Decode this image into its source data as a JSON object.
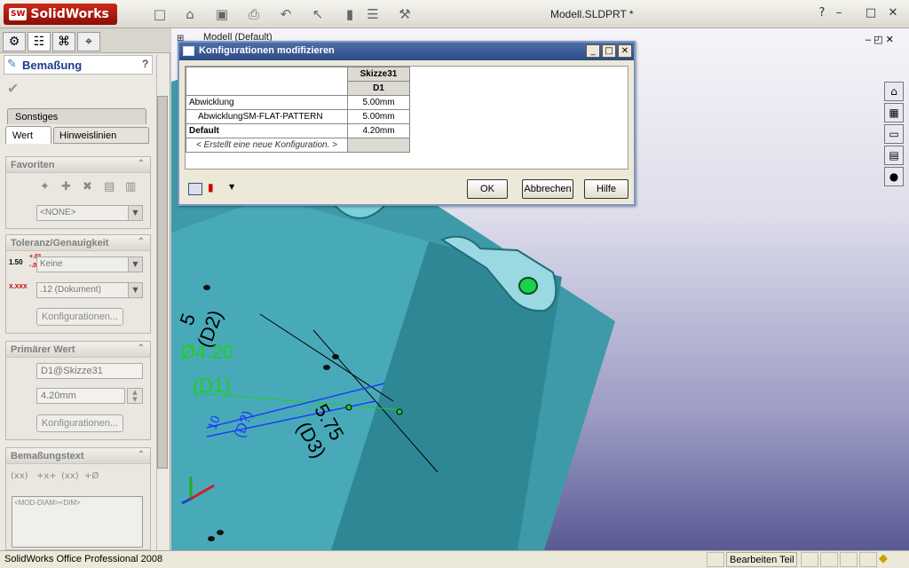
{
  "app": {
    "logo_text": "SolidWorks",
    "logo_badge": "SW",
    "document_title": "Modell.SLDPRT *"
  },
  "titlebar_icons": [
    "new-icon",
    "open-icon",
    "save-icon",
    "print-icon",
    "undo-icon",
    "select-icon",
    "rebuild-icon",
    "options-icon",
    "tools-icon"
  ],
  "panel": {
    "header_title": "Bemaßung",
    "help": "?",
    "tabs": {
      "other": "Sonstiges",
      "value": "Wert",
      "leaders": "Hinweislinien"
    },
    "favorites": {
      "title": "Favoriten",
      "combo": "<NONE>"
    },
    "tolerance": {
      "title": "Toleranz/Genauigkeit",
      "tol_icon_text": "1.50",
      "tol_plus": "+.01",
      "tol_minus": "-.01",
      "tol_combo": "Keine",
      "prec_icon_text": "X.XXX",
      "prec_combo": ".12 (Dokument)",
      "config_button": "Konfigurationen..."
    },
    "primary": {
      "title": "Primärer Wert",
      "name_field": "D1@Skizze31",
      "value_field": "4.20mm",
      "config_button": "Konfigurationen..."
    },
    "dimtext": {
      "title": "Bemaßungstext",
      "icons": [
        "(xx)",
        "+x+",
        "(xx)",
        "+Ø"
      ],
      "textbox": "<MOD-DIAM><DIM>"
    }
  },
  "viewport": {
    "model_label": "Modell  (Default)"
  },
  "dialog": {
    "title": "Konfigurationen modifizieren",
    "col_group": "Skizze31",
    "col_name": "D1",
    "rows": [
      {
        "label": "Abwicklung",
        "value": "5.00mm",
        "indent": false,
        "bold": false
      },
      {
        "label": "AbwicklungSM-FLAT-PATTERN",
        "value": "5.00mm",
        "indent": true,
        "bold": false
      },
      {
        "label": "Default",
        "value": "4.20mm",
        "indent": false,
        "bold": true
      }
    ],
    "new_config": "< Erstellt eine neue Konfiguration. >",
    "ok": "OK",
    "cancel": "Abbrechen",
    "help": "Hilfe"
  },
  "annotations": {
    "d2_value": "5",
    "d2_name": "(D2)",
    "d1_value": "Ø4.20",
    "d1_name": "(D1)",
    "d3_value": "5.75",
    "d3_name": "(D3)",
    "blue_value": "10",
    "blue_name": "(D?)"
  },
  "status": {
    "left": "SolidWorks Office Professional 2008",
    "mode": "Bearbeiten Teil"
  },
  "colors": {
    "accent": "#2b4a86",
    "model": "#3fa6b4",
    "dimension_green": "#22cc22",
    "dimension_blue": "#1a3cff"
  }
}
